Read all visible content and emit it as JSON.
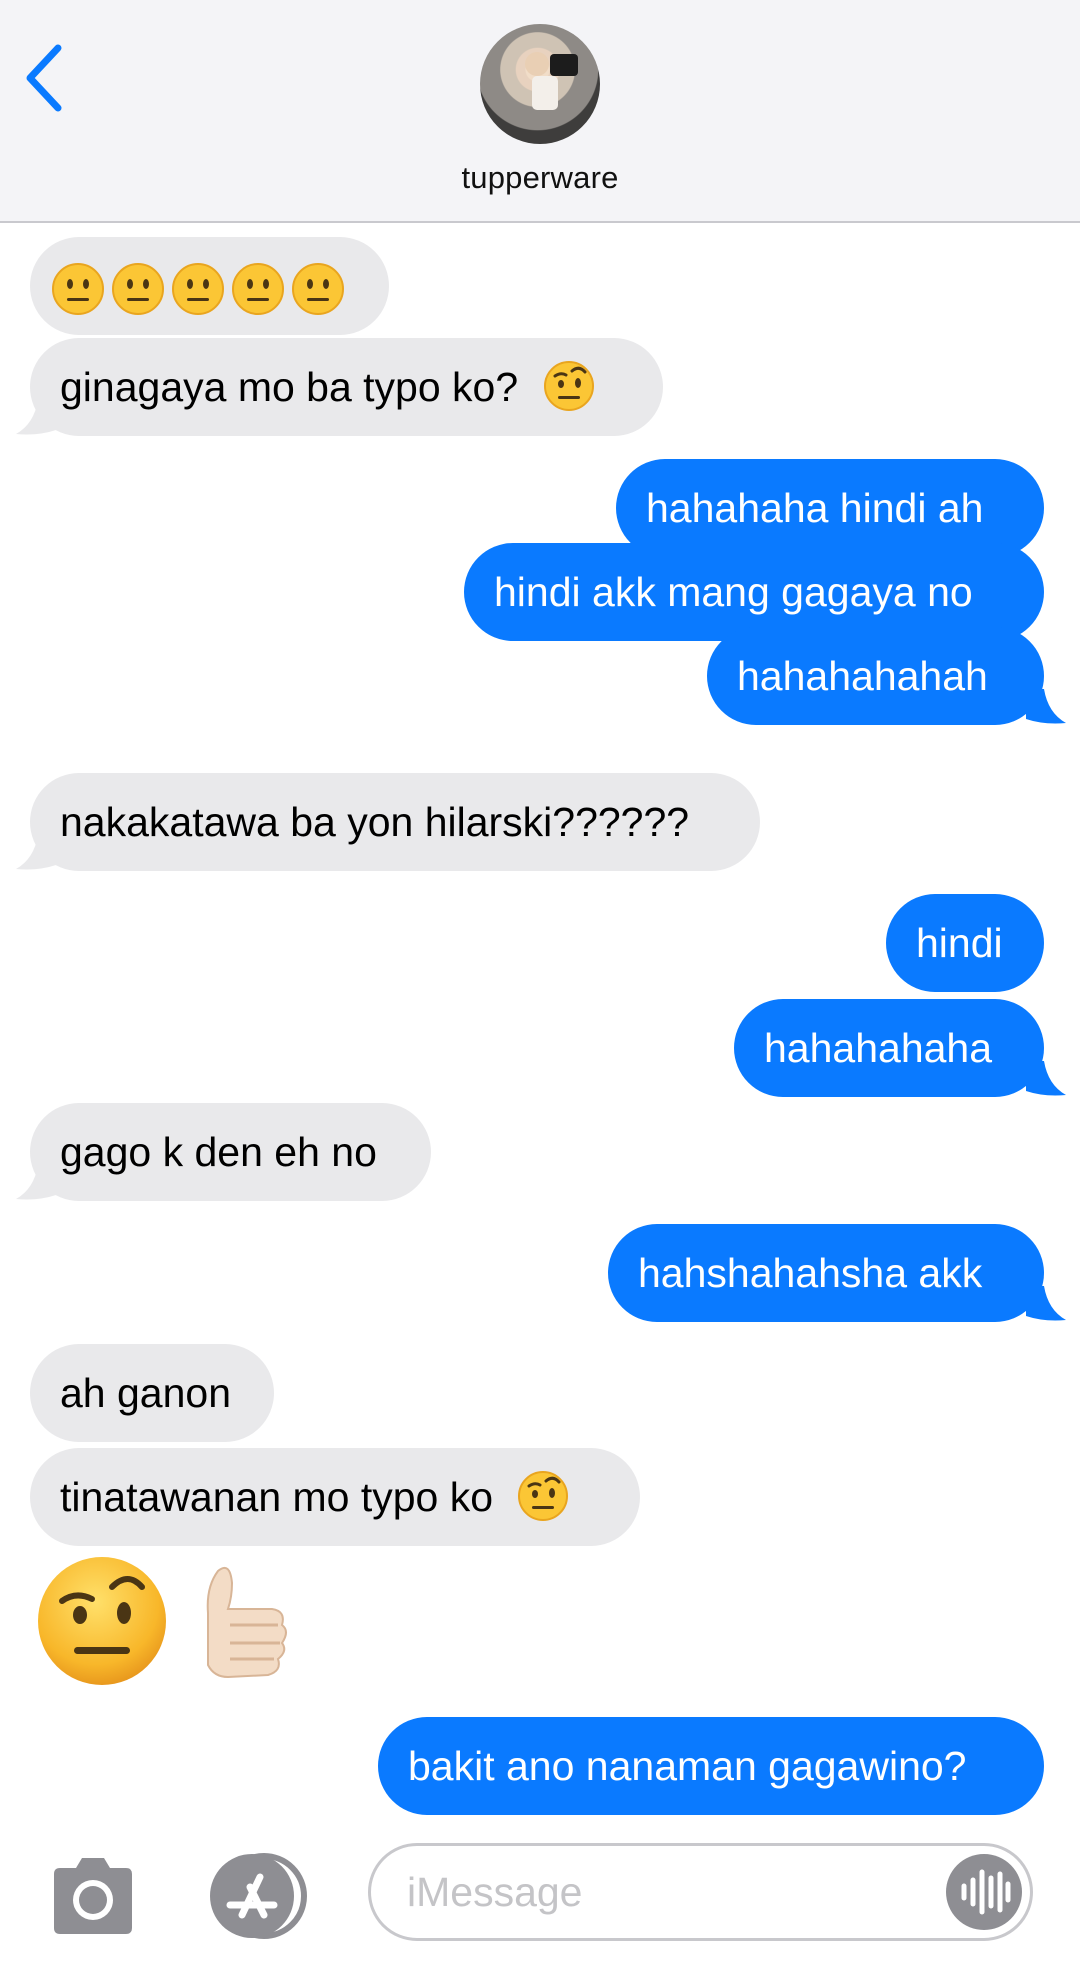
{
  "header": {
    "contact_name": "tupperware",
    "back_icon": "chevron-left-icon",
    "accent_color": "#0a7aff"
  },
  "messages": [
    {
      "from": "contact",
      "emoji_only": [
        "neutral-face-emoji",
        "neutral-face-emoji",
        "neutral-face-emoji",
        "neutral-face-emoji",
        "neutral-face-emoji"
      ]
    },
    {
      "from": "contact",
      "text": "ginagaya mo ba typo ko?",
      "emoji": "raised-eyebrow-emoji"
    },
    {
      "from": "me",
      "text": "hahahaha hindi ah"
    },
    {
      "from": "me",
      "text": "hindi akk mang gagaya no"
    },
    {
      "from": "me",
      "text": "hahahahahah"
    },
    {
      "from": "contact",
      "text": "nakakatawa ba yon hilarski??????"
    },
    {
      "from": "me",
      "text": "hindi"
    },
    {
      "from": "me",
      "text": "hahahahaha"
    },
    {
      "from": "contact",
      "text": "gago k den eh no"
    },
    {
      "from": "me",
      "text": "hahshahahsha akk"
    },
    {
      "from": "contact",
      "text": "ah ganon"
    },
    {
      "from": "contact",
      "text": "tinatawanan mo typo ko",
      "emoji": "raised-eyebrow-emoji"
    },
    {
      "from": "contact",
      "big_emoji": [
        "raised-eyebrow-emoji",
        "thumbs-up-emoji"
      ]
    },
    {
      "from": "me",
      "text": "bakit ano nanaman gagawino?"
    }
  ],
  "input": {
    "placeholder": "iMessage",
    "camera_icon": "camera-icon",
    "apps_icon": "app-store-icon",
    "audio_icon": "audio-waveform-icon"
  },
  "colors": {
    "sent_bubble": "#0a7aff",
    "received_bubble": "#e9e9eb"
  }
}
